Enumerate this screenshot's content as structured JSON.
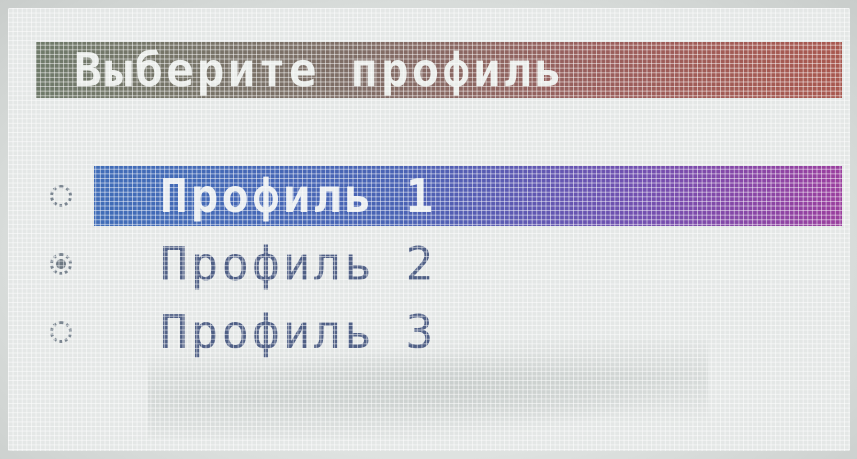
{
  "screen": {
    "title": "Выберите профиль"
  },
  "menu": {
    "items": [
      {
        "label": "Профиль 1",
        "selected": true,
        "checked": false,
        "icon": "radio-unchecked-icon"
      },
      {
        "label": "Профиль 2",
        "selected": false,
        "checked": true,
        "icon": "radio-checked-icon"
      },
      {
        "label": "Профиль 3",
        "selected": false,
        "checked": false,
        "icon": "radio-unchecked-icon"
      }
    ]
  },
  "colors": {
    "title_bar_start": "#6f7a6a",
    "title_bar_end": "#a8584f",
    "highlight_start": "#3f6fb8",
    "highlight_end": "#9a3f9e",
    "text_normal": "#4f5f85",
    "text_on_highlight": "#e8ecef",
    "screen_background": "#e4e7e6"
  }
}
